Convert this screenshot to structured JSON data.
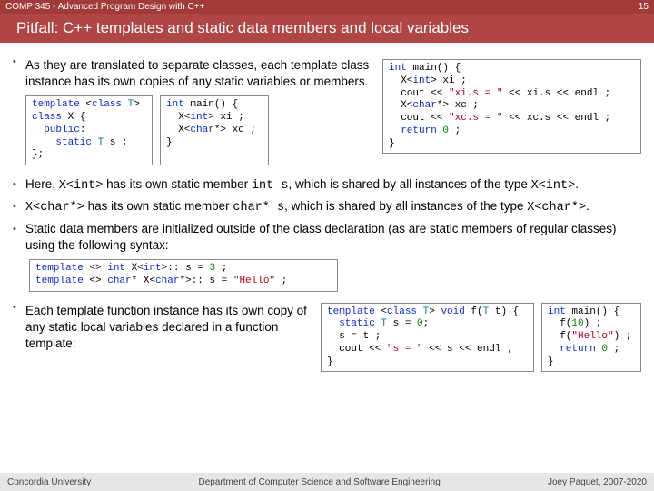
{
  "header": {
    "course": "COMP 345 - Advanced Program Design with C++",
    "page": "15",
    "title": "Pitfall: C++ templates and static data members and local variables"
  },
  "bullets": {
    "b1_a": "As they are translated to separate classes, each template class instance has its own copies of any static variables or members.",
    "b2_pre": "Here, ",
    "b2_code1": "X<int>",
    "b2_mid": " has its own static member ",
    "b2_code2": "int s",
    "b2_post": ", which is shared by all instances of the type ",
    "b2_code3": "X<int>",
    "b2_end": ".",
    "b3_code1": "X<char*>",
    "b3_mid": " has its own static member ",
    "b3_code2": "char* s",
    "b3_post": ", which is shared by all instances of the type ",
    "b3_code3": "X<char*>",
    "b3_end": ".",
    "b4": "Static data members are initialized outside of the class declaration (as are static members of regular classes) using the following syntax:",
    "b5": "Each template function instance has its own copy of any static local variables declared in a function template:"
  },
  "code": {
    "c1": "template <class T>\nclass X {\n  public:\n    static T s ;\n};",
    "c2": "int main() {\n  X<int> xi ;\n  X<char*> xc ;\n}",
    "c3": "int main() {\n  X<int> xi ;\n  cout << \"xi.s = \" << xi.s << endl ;\n  X<char*> xc ;\n  cout << \"xc.s = \" << xc.s << endl ;\n  return 0 ;\n}",
    "c4": "template <> int X<int>:: s = 3 ;\ntemplate <> char* X<char*>:: s = \"Hello\" ;",
    "c5": "template <class T> void f(T t) {\n  static T s = 0;\n  s = t ;\n  cout << \"s = \" << s << endl ;\n}",
    "c6": "int main() {\n  f(10) ;\n  f(\"Hello\") ;\n  return 0 ;\n}"
  },
  "footer": {
    "left": "Concordia University",
    "center": "Department of Computer Science and Software Engineering",
    "right": "Joey Paquet, 2007-2020"
  }
}
